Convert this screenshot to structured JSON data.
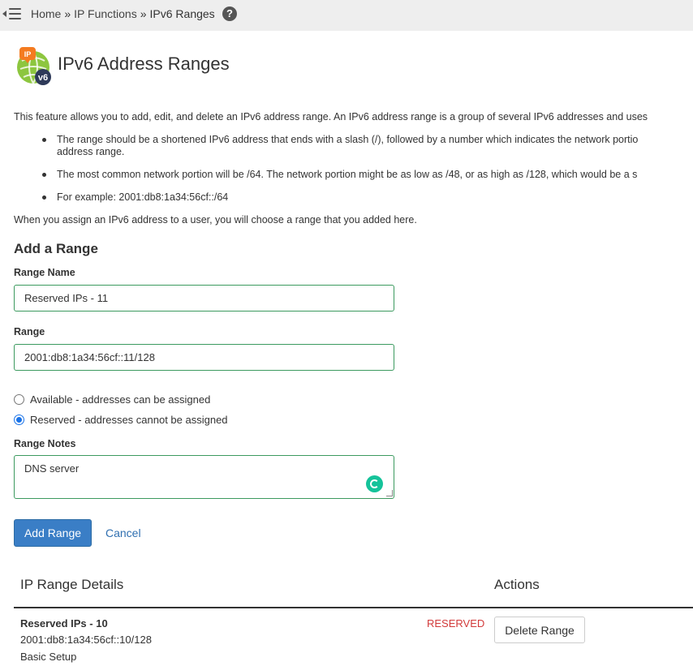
{
  "breadcrumb": {
    "home": "Home",
    "ip_functions": "IP Functions",
    "current": "IPv6 Ranges",
    "separator": "»"
  },
  "header": {
    "title": "IPv6 Address Ranges",
    "icon": "ipv6-globe-icon",
    "icon_badge_ip": "IP",
    "icon_badge_v6": "v6"
  },
  "description": {
    "intro": "This feature allows you to add, edit, and delete an IPv6 address range. An IPv6 address range is a group of several IPv6 addresses and uses",
    "bullets": [
      "The range should be a shortened IPv6 address that ends with a slash (/), followed by a number which indicates the network portio",
      "The most common network portion will be /64. The network portion might be as low as /48, or as high as /128, which would be a s",
      "For example: 2001:db8:1a34:56cf::/64"
    ],
    "bullet1_cont": "address range.",
    "assign_note": "When you assign an IPv6 address to a user, you will choose a range that you added here."
  },
  "form": {
    "section_title": "Add a Range",
    "range_name_label": "Range Name",
    "range_name_value": "Reserved IPs - 11",
    "range_label": "Range",
    "range_value": "2001:db8:1a34:56cf::11/128",
    "radio_available": "Available - addresses can be assigned",
    "radio_reserved": "Reserved - addresses cannot be assigned",
    "selected_radio": "reserved",
    "notes_label": "Range Notes",
    "notes_value": "DNS server",
    "submit_label": "Add Range",
    "cancel_label": "Cancel"
  },
  "table": {
    "col_details": "IP Range Details",
    "col_actions": "Actions",
    "rows": [
      {
        "name": "Reserved IPs - 10",
        "range": "2001:db8:1a34:56cf::10/128",
        "notes": "Basic Setup",
        "status": "RESERVED",
        "action_label": "Delete Range"
      }
    ]
  },
  "colors": {
    "primary_button": "#3a7ec6",
    "input_border": "#3c9a5f",
    "status_reserved": "#d23a3a",
    "link": "#2f6fb0"
  }
}
